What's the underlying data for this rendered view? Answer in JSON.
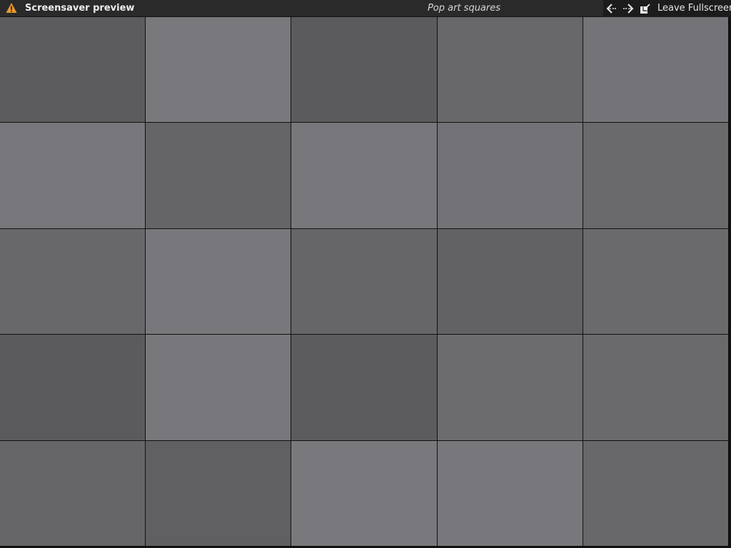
{
  "titlebar": {
    "title": "Screensaver preview",
    "subtitle": "Pop art squares",
    "warning_icon": "warning-triangle-icon",
    "warning_color": "#e89a2c"
  },
  "controls": {
    "prev_icon": "previous-arrow-icon",
    "next_icon": "next-arrow-icon",
    "leave_icon": "leave-fullscreen-icon",
    "leave_label": "Leave Fullscreen"
  },
  "screensaver": {
    "rows": 5,
    "columns": 5,
    "tile_colors": [
      [
        "#5c5c5e",
        "#79787c",
        "#5b5b5d",
        "#68686a",
        "#747377"
      ],
      [
        "#78777b",
        "#656467",
        "#78777b",
        "#737276",
        "#6a696c"
      ],
      [
        "#68676a",
        "#78777b",
        "#666568",
        "#626164",
        "#6a696c"
      ],
      [
        "#5b5b5d",
        "#78777b",
        "#5c5c5e",
        "#6c6b6e",
        "#6a696c"
      ],
      [
        "#666568",
        "#606062",
        "#79787c",
        "#78777b",
        "#68686a"
      ]
    ]
  }
}
